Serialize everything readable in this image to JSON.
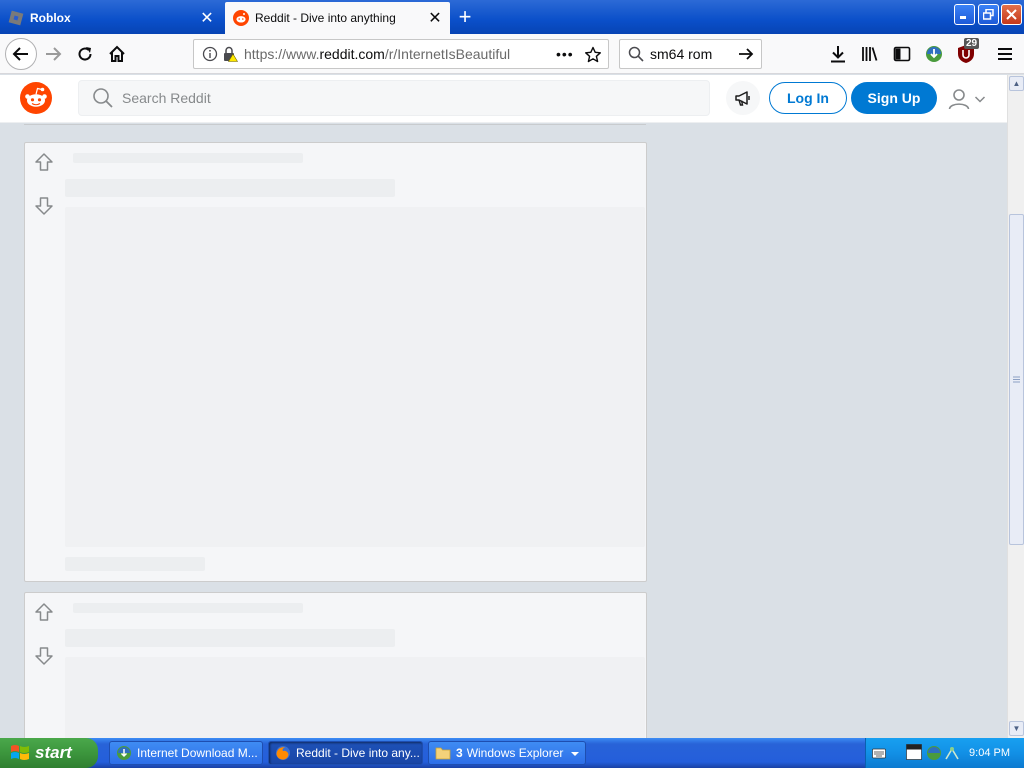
{
  "browser": {
    "tabs": [
      {
        "title": "Roblox",
        "icon": "roblox-icon",
        "active": false
      },
      {
        "title": "Reddit - Dive into anything",
        "icon": "reddit-icon",
        "active": true
      }
    ],
    "url": {
      "prefix": "https://www.",
      "host": "reddit.com",
      "path": "/r/InternetIsBeautiful"
    },
    "search_value": "sm64 rom",
    "addon_badge": "29"
  },
  "reddit": {
    "search_placeholder": "Search Reddit",
    "login_label": "Log In",
    "signup_label": "Sign Up",
    "brand_color": "#ff4500",
    "accent_color": "#0079d3"
  },
  "taskbar": {
    "start_label": "start",
    "items": [
      {
        "label": "Internet Download M...",
        "icon": "idm-icon"
      },
      {
        "label": "Reddit - Dive into any...",
        "icon": "firefox-icon"
      },
      {
        "label": "Windows Explorer",
        "count": "3",
        "icon": "folder-icon"
      }
    ],
    "clock": "9:04 PM"
  }
}
